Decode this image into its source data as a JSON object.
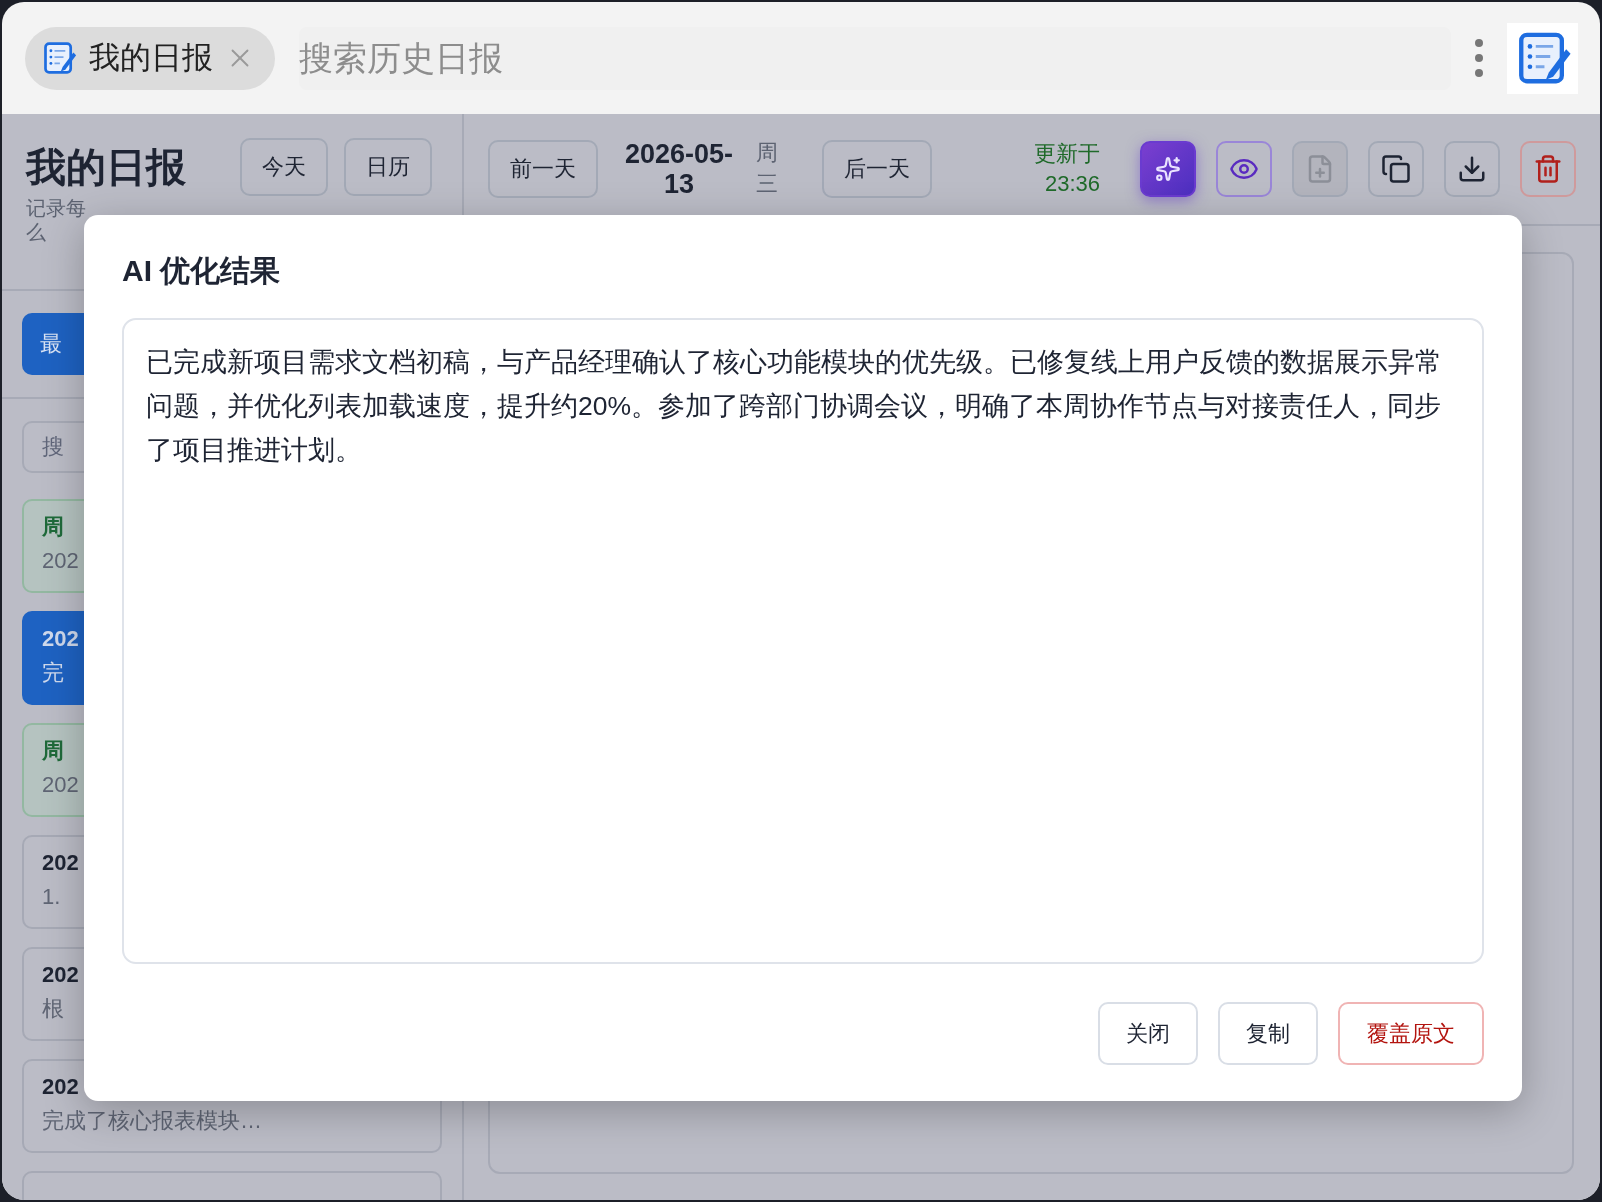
{
  "tab": {
    "title": "我的日报"
  },
  "search": {
    "placeholder": "搜索历史日报"
  },
  "sidebar": {
    "title": "我的日报",
    "subtitle": [
      "记录每",
      "么"
    ],
    "buttons": [
      "今天",
      "日历"
    ],
    "filter_button": {
      "label": "最",
      "selected": true
    },
    "search": {
      "placeholder": "搜"
    },
    "items": [
      {
        "kind": "weekly",
        "selected": false,
        "title": "周",
        "preview": "202"
      },
      {
        "kind": "daily",
        "selected": true,
        "title": "202",
        "preview": "完"
      },
      {
        "kind": "weekly",
        "selected": false,
        "title": "周",
        "preview": "202"
      },
      {
        "kind": "daily",
        "selected": false,
        "title": "202",
        "preview": "1."
      },
      {
        "kind": "daily",
        "selected": false,
        "title": "202",
        "preview": "根"
      },
      {
        "kind": "daily",
        "selected": false,
        "title": "202",
        "preview": "完成了核心报表模块…"
      }
    ]
  },
  "toolbar": {
    "prev": "前一天",
    "date": "2026-05-13",
    "weekday": "周三",
    "next": "后一天",
    "updated": "更新于 23:36",
    "actions": [
      {
        "kind": "ai",
        "active": true,
        "disabled": false
      },
      {
        "kind": "preview",
        "active": true,
        "disabled": false
      },
      {
        "kind": "new",
        "active": false,
        "disabled": true
      },
      {
        "kind": "copy",
        "active": false,
        "disabled": false
      },
      {
        "kind": "download",
        "active": false,
        "disabled": false
      },
      {
        "kind": "delete",
        "active": false,
        "disabled": false
      }
    ]
  },
  "dialog": {
    "title": "AI 优化结果",
    "content": "已完成新项目需求文档初稿，与产品经理确认了核心功能模块的优先级。已修复线上用户反馈的数据展示异常问题，并优化列表加载速度，提升约20%。参加了跨部门协调会议，明确了本周协作节点与对接责任人，同步了项目推进计划。",
    "buttons": [
      {
        "label": "关闭",
        "kind": "default"
      },
      {
        "label": "复制",
        "kind": "default"
      },
      {
        "label": "覆盖原文",
        "kind": "danger"
      }
    ]
  }
}
